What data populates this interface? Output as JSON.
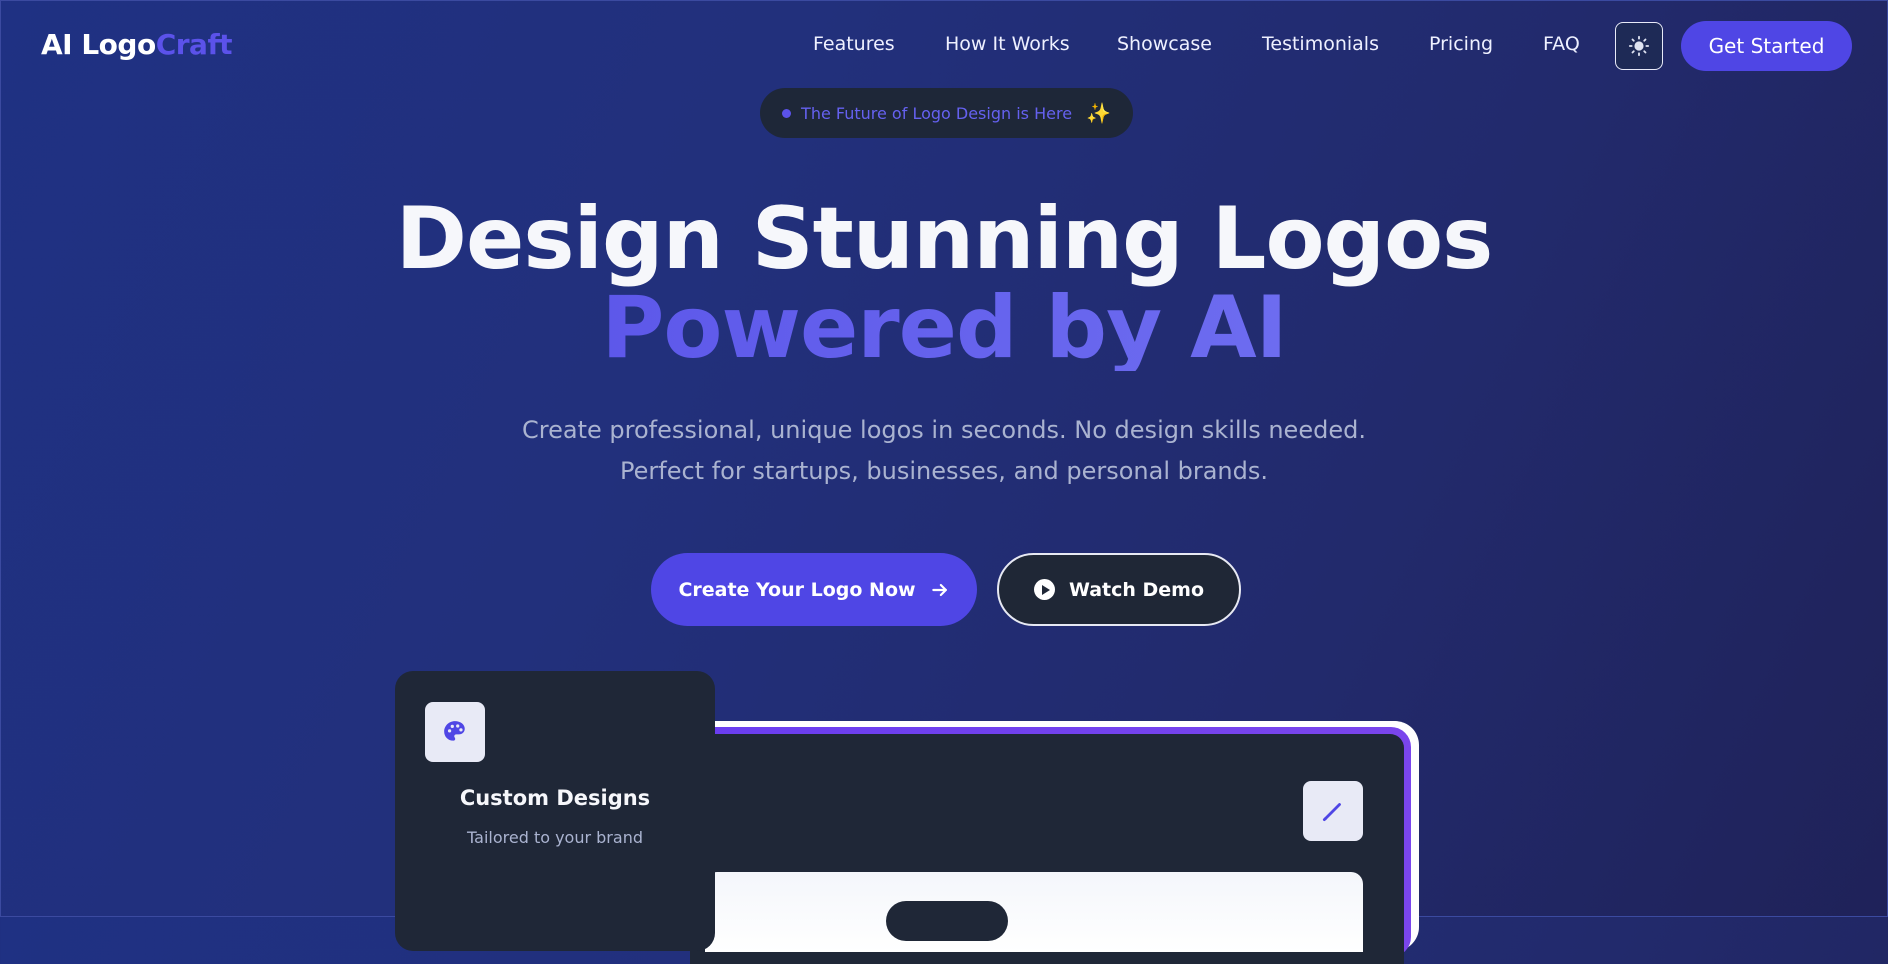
{
  "brand": {
    "part1": "AI Logo",
    "part2": "Craft"
  },
  "nav": {
    "items": [
      "Features",
      "How It Works",
      "Showcase",
      "Testimonials",
      "Pricing",
      "FAQ"
    ],
    "theme_icon": "sun-icon",
    "cta_label": "Get Started"
  },
  "badge": {
    "text": "The Future of Logo Design is Here",
    "icon": "sparkles-icon"
  },
  "hero": {
    "title_line1": "Design Stunning Logos",
    "title_line2": "Powered by AI",
    "subtitle_line1": "Create professional, unique logos in seconds. No design skills needed.",
    "subtitle_line2": "Perfect for startups, businesses, and personal brands.",
    "primary_cta": "Create Your Logo Now",
    "primary_cta_icon": "arrow-right-icon",
    "secondary_cta": "Watch Demo",
    "secondary_cta_icon": "play-icon"
  },
  "feature_card": {
    "icon": "palette-icon",
    "title": "Custom Designs",
    "subtitle": "Tailored to your brand"
  },
  "preview": {
    "edit_icon": "pencil-icon"
  },
  "colors": {
    "accent": "#4f46e5",
    "background": "#1f3183",
    "card": "#1f2737"
  }
}
